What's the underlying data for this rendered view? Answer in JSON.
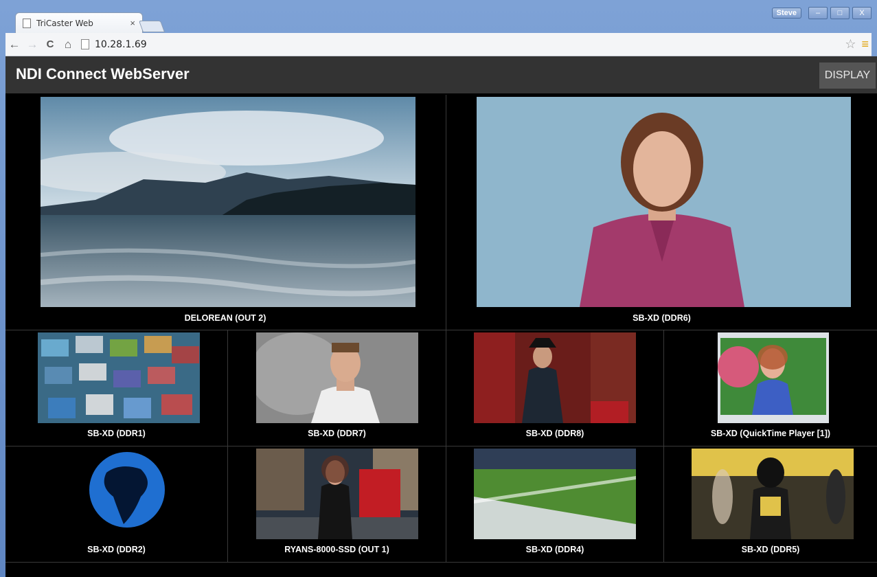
{
  "browser": {
    "tab_title": "TriCaster Web",
    "tab_close": "×",
    "url": "10.28.1.69",
    "user": "Steve",
    "buttons": {
      "back": "←",
      "forward": "→",
      "reload": "C",
      "home": "⌂",
      "star": "☆",
      "menu": "≡"
    },
    "window_buttons": {
      "minimize": "–",
      "maximize": "□",
      "close": "X"
    }
  },
  "app": {
    "title": "NDI Connect WebServer",
    "display_button": "DISPLAY"
  },
  "sources": {
    "large": [
      {
        "label": "DELOREAN (OUT 2)"
      },
      {
        "label": "SB-XD (DDR6)"
      }
    ],
    "row1": [
      {
        "label": "SB-XD (DDR1)"
      },
      {
        "label": "SB-XD (DDR7)"
      },
      {
        "label": "SB-XD (DDR8)"
      },
      {
        "label": "SB-XD (QuickTime Player [1])"
      }
    ],
    "row2": [
      {
        "label": "SB-XD (DDR2)"
      },
      {
        "label": "RYANS-8000-SSD (OUT 1)"
      },
      {
        "label": "SB-XD (DDR4)"
      },
      {
        "label": "SB-XD (DDR5)"
      }
    ]
  }
}
